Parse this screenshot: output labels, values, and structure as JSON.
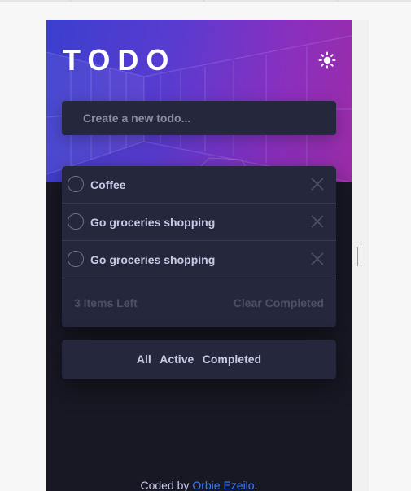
{
  "app": {
    "title": "TODO",
    "theme_toggle_icon": "sun-icon",
    "new_todo": {
      "placeholder": "Create a new todo...",
      "value": ""
    },
    "todos": [
      {
        "text": "Coffee",
        "completed": false
      },
      {
        "text": "Go groceries shopping",
        "completed": false
      },
      {
        "text": "Go groceries shopping",
        "completed": false
      }
    ],
    "footer": {
      "items_left": "3 Items Left",
      "clear_completed": "Clear Completed"
    },
    "filters": [
      "All",
      "Active",
      "Completed"
    ]
  },
  "credit": {
    "prefix": "Coded by ",
    "author": "Orbie Ezeilo",
    "suffix": "."
  },
  "colors": {
    "background": "#171823",
    "card": "#25273d",
    "text": "#c8cbe7",
    "muted": "#4d5067",
    "link": "#3a7bfd",
    "hero_start": "#3a3fce",
    "hero_end": "#9c2ca8"
  }
}
